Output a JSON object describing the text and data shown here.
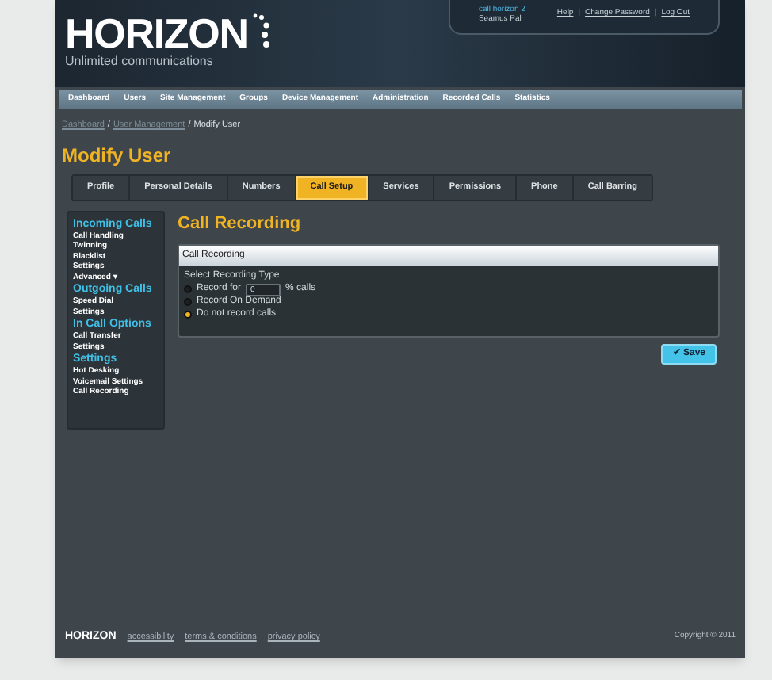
{
  "header": {
    "logo": "HORIZON",
    "tagline": "Unlimited communications",
    "user": {
      "line_1": "call horizon 2",
      "line_2": "Seamus Pal"
    },
    "links": [
      "Help",
      "Change Password",
      "Log Out"
    ],
    "separators": [
      "|",
      "|"
    ]
  },
  "nav": [
    "Dashboard",
    "Users",
    "Site Management",
    "Groups",
    "Device Management",
    "Administration",
    "Recorded Calls",
    "Statistics"
  ],
  "breadcrumb": {
    "items": [
      {
        "label": "Dashboard",
        "link": true
      },
      {
        "label": "User Management",
        "link": true
      },
      {
        "label": "Modify User",
        "link": false
      }
    ],
    "separators": [
      "/",
      "/"
    ]
  },
  "page_title": "Modify User",
  "tabs": [
    {
      "label": "Profile",
      "selected": false
    },
    {
      "label": "Personal Details",
      "selected": false
    },
    {
      "label": "Numbers",
      "selected": false
    },
    {
      "label": "Call Setup",
      "selected": true
    },
    {
      "label": "Services",
      "selected": false
    },
    {
      "label": "Permissions",
      "selected": false
    },
    {
      "label": "Phone",
      "selected": false
    },
    {
      "label": "Call Barring",
      "selected": false
    }
  ],
  "sidebar": [
    {
      "heading": "Incoming Calls",
      "items": [
        "Call Handling",
        "Twinning",
        "Blacklist",
        "Settings",
        "Advanced ▾"
      ]
    },
    {
      "heading": "Outgoing Calls",
      "items": [
        "Speed Dial",
        "Settings"
      ]
    },
    {
      "heading": "In Call Options",
      "items": [
        "Call Transfer",
        "Settings"
      ]
    },
    {
      "heading": "Settings",
      "items": [
        "Hot Desking",
        "Voicemail Settings",
        "Call Recording"
      ]
    }
  ],
  "section_title": "Call Recording",
  "panel": {
    "title": "Call Recording",
    "label": "Select Recording Type",
    "options": [
      {
        "kind": "percent",
        "label": "Record for",
        "value": "0",
        "suffix": "% calls",
        "selected": false
      },
      {
        "kind": "plain",
        "label": "Record On Demand",
        "selected": false
      },
      {
        "kind": "plain",
        "label": "Do not record calls",
        "selected": true
      }
    ]
  },
  "save_button": "✔ Save",
  "footer": {
    "logo": "HORIZON",
    "links": [
      "accessibility",
      "terms & conditions",
      "privacy policy"
    ],
    "copyright": "Copyright © 2011"
  }
}
